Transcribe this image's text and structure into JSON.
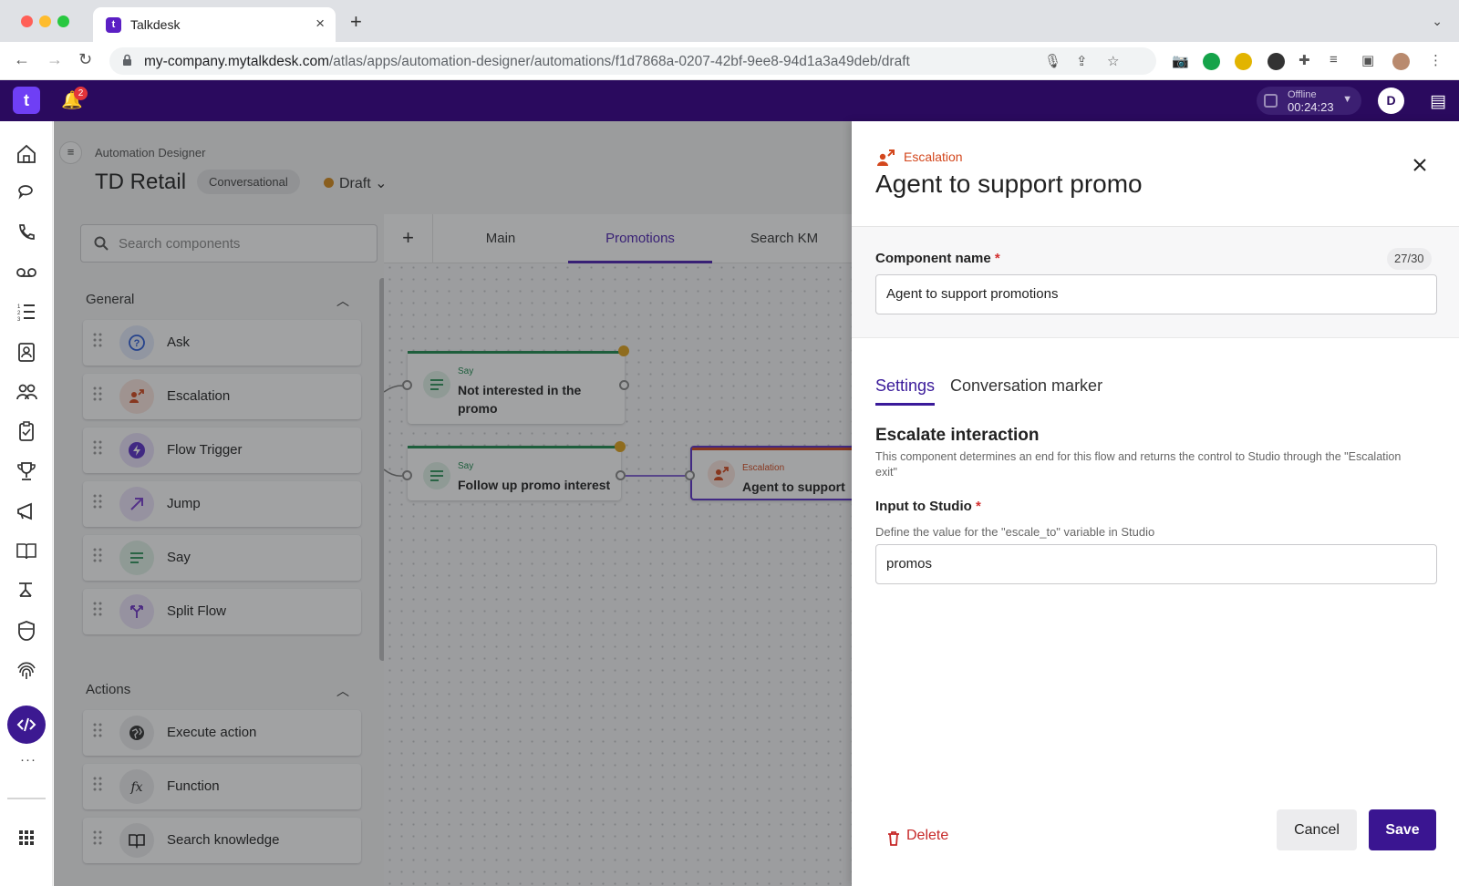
{
  "browser": {
    "tab_title": "Talkdesk",
    "tab_favicon": "t",
    "url_host": "my-company.mytalkdesk.com",
    "url_path": "/atlas/apps/automation-designer/automations/f1d7868a-0207-42bf-9ee8-94d1a3a49deb/draft"
  },
  "appbar": {
    "logo": "t",
    "notification_count": "2",
    "status_label": "Offline",
    "status_timer": "00:24:23",
    "user_initial": "D"
  },
  "main": {
    "breadcrumb": "Automation Designer",
    "title": "TD Retail",
    "type_tag": "Conversational",
    "status": "Draft",
    "search_placeholder": "Search components",
    "sections": [
      {
        "title": "General",
        "items": [
          {
            "label": "Ask",
            "icon": "question-icon",
            "color": "#2a5bd7"
          },
          {
            "label": "Escalation",
            "icon": "escalation-icon",
            "color": "#d3471d"
          },
          {
            "label": "Flow Trigger",
            "icon": "flow-trigger-icon",
            "color": "#5b2fc9"
          },
          {
            "label": "Jump",
            "icon": "jump-arrow-icon",
            "color": "#7b3fd0"
          },
          {
            "label": "Say",
            "icon": "say-lines-icon",
            "color": "#1e8a4f"
          },
          {
            "label": "Split Flow",
            "icon": "split-flow-icon",
            "color": "#6b2fc7"
          }
        ]
      },
      {
        "title": "Actions",
        "items": [
          {
            "label": "Execute action",
            "icon": "globe-icon",
            "color": "#222"
          },
          {
            "label": "Function",
            "icon": "function-icon",
            "color": "#222"
          },
          {
            "label": "Search knowledge",
            "icon": "book-icon",
            "color": "#222"
          }
        ]
      }
    ],
    "canvas_tabs": [
      "Main",
      "Promotions",
      "Search KM"
    ],
    "active_canvas_tab": "Promotions",
    "nodes": [
      {
        "type": "Say",
        "title": "Not interested in the promo"
      },
      {
        "type": "Say",
        "title": "Follow up promo interest"
      },
      {
        "type": "Escalation",
        "title": "Agent to support"
      }
    ]
  },
  "drawer": {
    "kind": "Escalation",
    "title": "Agent to support promo",
    "component_name_label": "Component name",
    "required_mark": "*",
    "char_counter": "27/30",
    "component_name_value": "Agent to support promotions",
    "tabs": [
      "Settings",
      "Conversation marker"
    ],
    "active_tab": "Settings",
    "section_title": "Escalate interaction",
    "section_description": "This component determines an end for this flow and returns the control to Studio through the \"Escalation exit\"",
    "input_label": "Input to Studio",
    "input_help": "Define the value for the \"escale_to\" variable in Studio",
    "input_value": "promos",
    "delete_label": "Delete",
    "cancel_label": "Cancel",
    "save_label": "Save"
  },
  "colors": {
    "brand": "#2a0a5e",
    "primary": "#3a1591",
    "escalation": "#d3471d",
    "danger": "#c62828"
  }
}
